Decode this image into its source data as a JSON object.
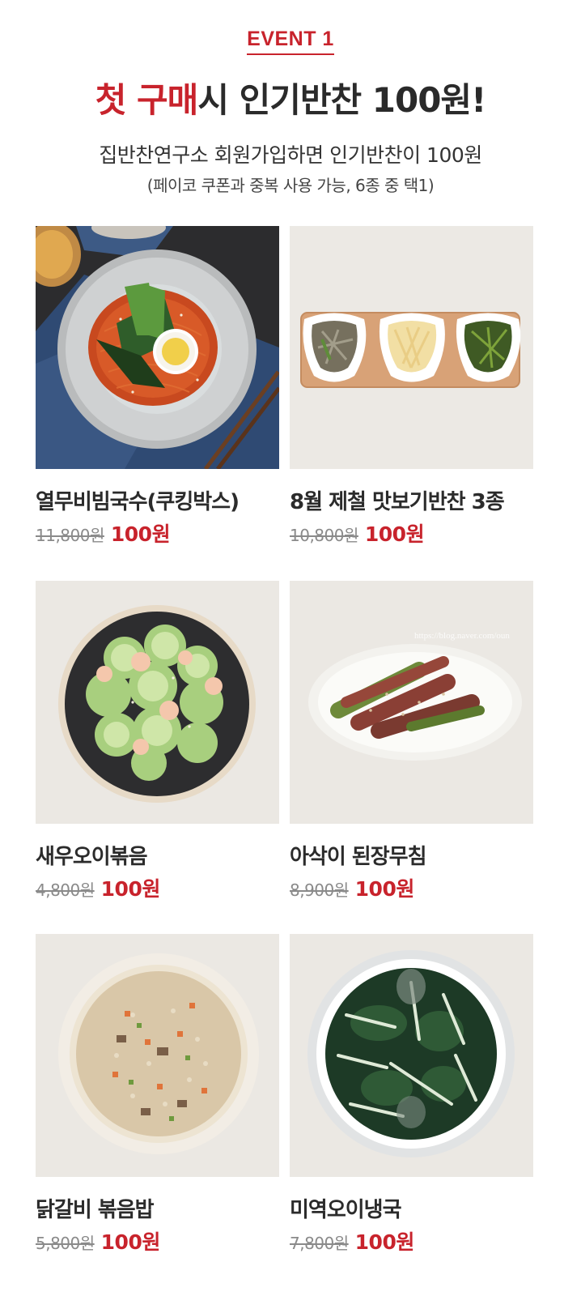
{
  "event": {
    "tag": "EVENT 1",
    "headline_red": "첫 구매",
    "headline_rest": "시 인기반찬 100원!",
    "subtitle": "집반찬연구소 회원가입하면 인기반찬이 100원",
    "note": "(페이코 쿠폰과 중복 사용 가능, 6종 중 택1)"
  },
  "products": [
    {
      "name": "열무비빔국수(쿠킹박스)",
      "original_price": "11,800원",
      "event_price": "100원"
    },
    {
      "name": "8월 제철 맛보기반찬 3종",
      "original_price": "10,800원",
      "event_price": "100원"
    },
    {
      "name": "새우오이볶음",
      "original_price": "4,800원",
      "event_price": "100원"
    },
    {
      "name": "아삭이 된장무침",
      "original_price": "8,900원",
      "event_price": "100원"
    },
    {
      "name": "닭갈비 볶음밥",
      "original_price": "5,800원",
      "event_price": "100원"
    },
    {
      "name": "미역오이냉국",
      "original_price": "7,800원",
      "event_price": "100원"
    }
  ],
  "watermark": "https://blog.naver.com/oun",
  "colors": {
    "accent": "#c8232c",
    "text": "#2b2b2b",
    "strike": "#8a8a8a"
  }
}
